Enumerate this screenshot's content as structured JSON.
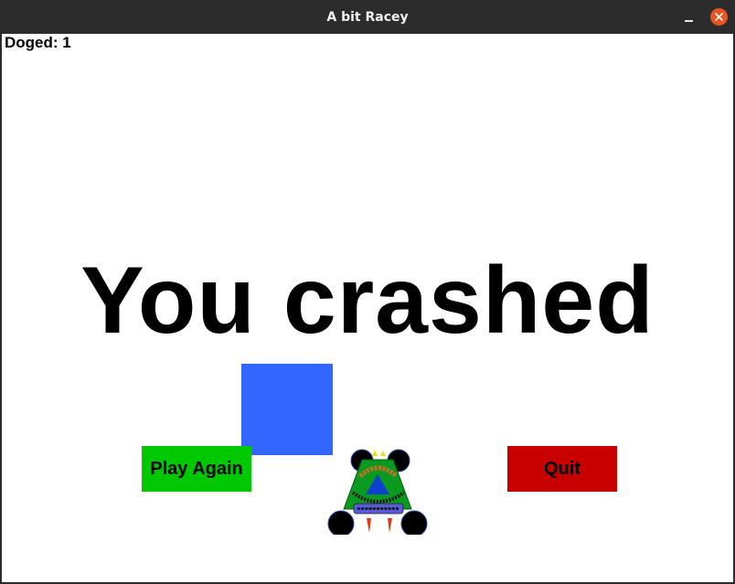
{
  "window": {
    "title": "A bit Racey"
  },
  "hud": {
    "score_label": "Doged: 1"
  },
  "message": {
    "text": "You crashed"
  },
  "buttons": {
    "play_again": "Play Again",
    "quit": "Quit"
  },
  "colors": {
    "play_again": "#00c800",
    "quit": "#c80000",
    "block": "#3366ff",
    "close": "#e95420"
  },
  "icons": {
    "car": "car-logo-icon",
    "close": "close-icon",
    "minimize": "minimize-icon"
  }
}
